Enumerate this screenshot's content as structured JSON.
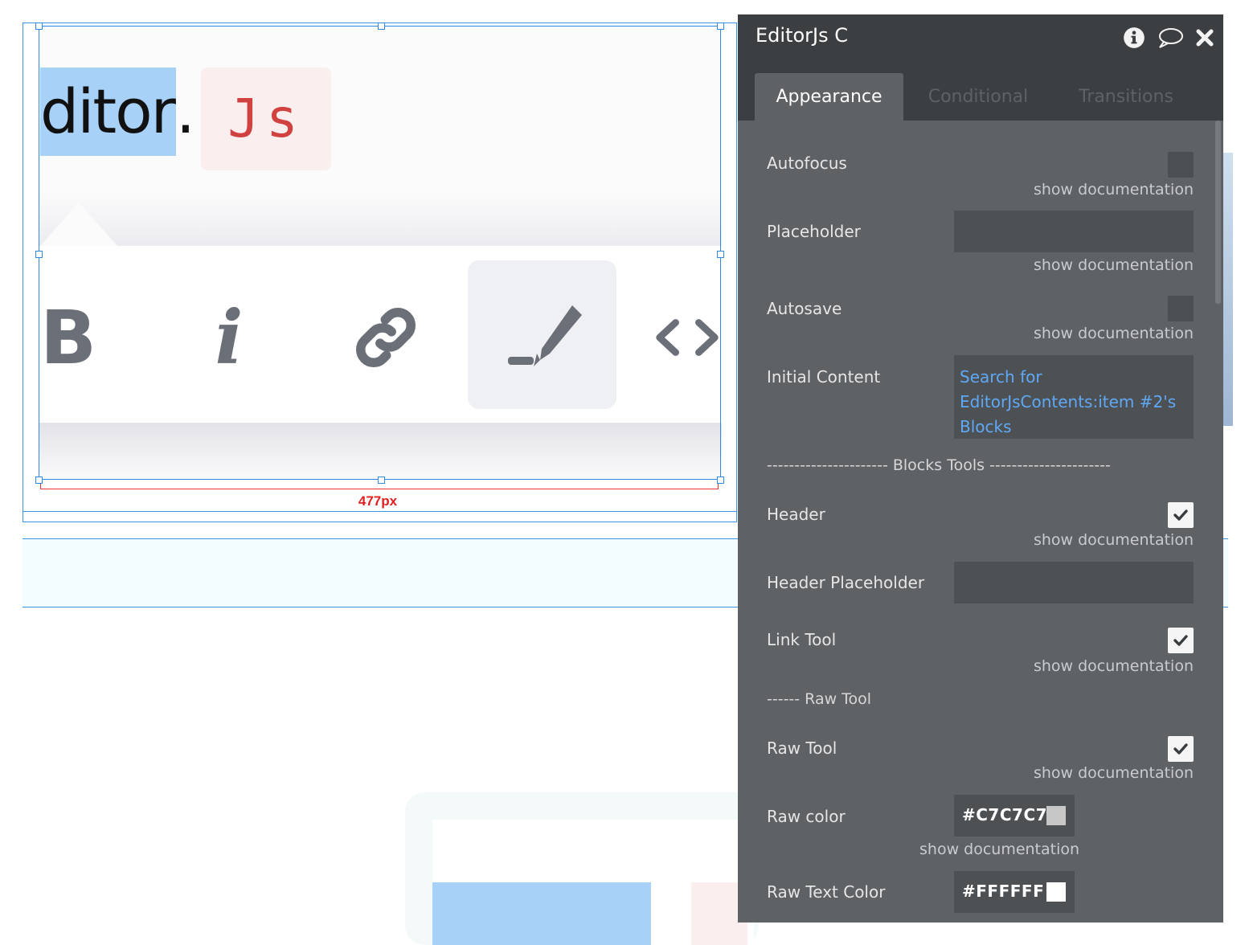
{
  "canvas": {
    "preview": {
      "selected_word": "ditor",
      "trailing_char": ".",
      "badge_text": "Js"
    },
    "toolbar": {
      "bold_label": "B",
      "italic_label": "i",
      "icons": [
        "link-icon",
        "marker-icon",
        "code-icon"
      ]
    },
    "dimension_label": "477px"
  },
  "panel": {
    "title": "EditorJs C",
    "header_icons": [
      "info-icon",
      "comment-icon",
      "close-icon"
    ],
    "tabs": [
      {
        "label": "Appearance",
        "active": true
      },
      {
        "label": "Conditional",
        "active": false
      },
      {
        "label": "Transitions",
        "active": false
      }
    ],
    "doc_link": "show documentation",
    "properties": {
      "autofocus": {
        "label": "Autofocus",
        "checked": false
      },
      "placeholder": {
        "label": "Placeholder",
        "value": ""
      },
      "autosave": {
        "label": "Autosave",
        "checked": false
      },
      "initial_content": {
        "label": "Initial Content",
        "value": "Search for EditorJsContents:item #2's Blocks"
      },
      "blocks_separator": "---------------------- Blocks Tools ----------------------",
      "header": {
        "label": "Header",
        "checked": true
      },
      "header_placeholder": {
        "label": "Header Placeholder",
        "value": ""
      },
      "link_tool": {
        "label": "Link Tool",
        "checked": true
      },
      "raw_separator": "------ Raw Tool",
      "raw_tool": {
        "label": "Raw Tool",
        "checked": true
      },
      "raw_color": {
        "label": "Raw color",
        "value": "#C7C7C7",
        "swatch": "#C7C7C7"
      },
      "raw_text_color": {
        "label": "Raw Text Color",
        "value": "#FFFFFF",
        "swatch": "#FFFFFF"
      }
    }
  },
  "colors": {
    "panel_bg": "#5F6265",
    "panel_header": "#3C3F41",
    "selection": "#2E8AE6",
    "dimension": "#E02020",
    "dynamic_text": "#5FA8F5"
  }
}
